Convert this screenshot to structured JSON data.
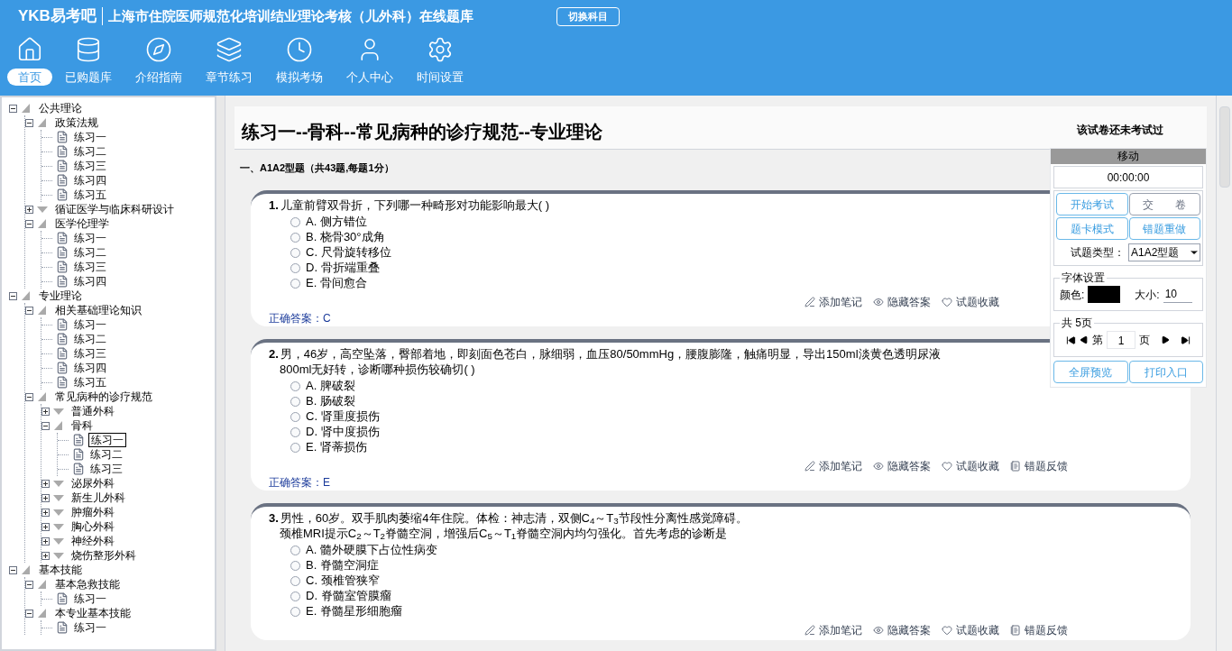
{
  "header": {
    "logo": "YKB易考吧",
    "title": "上海市住院医师规范化培训结业理论考核（儿外科）在线题库",
    "switch_button": "切换科目"
  },
  "nav": [
    {
      "label": "首页",
      "selected": true
    },
    {
      "label": "已购题库",
      "selected": false
    },
    {
      "label": "介绍指南",
      "selected": false
    },
    {
      "label": "章节练习",
      "selected": false
    },
    {
      "label": "模拟考场",
      "selected": false
    },
    {
      "label": "个人中心",
      "selected": false
    },
    {
      "label": "时间设置",
      "selected": false
    }
  ],
  "tree": [
    {
      "label": "公共理论",
      "expanded": true,
      "children": [
        {
          "label": "政策法规",
          "expanded": true,
          "children": [
            {
              "label": "练习一",
              "selected": false
            },
            {
              "label": "练习二",
              "selected": false
            },
            {
              "label": "练习三",
              "selected": false
            },
            {
              "label": "练习四",
              "selected": false
            },
            {
              "label": "练习五",
              "selected": false
            }
          ]
        },
        {
          "label": "循证医学与临床科研设计",
          "expanded": false
        },
        {
          "label": "医学伦理学",
          "expanded": true,
          "children": [
            {
              "label": "练习一",
              "selected": false
            },
            {
              "label": "练习二",
              "selected": false
            },
            {
              "label": "练习三",
              "selected": false
            },
            {
              "label": "练习四",
              "selected": false
            }
          ]
        }
      ]
    },
    {
      "label": "专业理论",
      "expanded": true,
      "children": [
        {
          "label": "相关基础理论知识",
          "expanded": true,
          "children": [
            {
              "label": "练习一",
              "selected": false
            },
            {
              "label": "练习二",
              "selected": false
            },
            {
              "label": "练习三",
              "selected": false
            },
            {
              "label": "练习四",
              "selected": false
            },
            {
              "label": "练习五",
              "selected": false
            }
          ]
        },
        {
          "label": "常见病种的诊疗规范",
          "expanded": true,
          "children": [
            {
              "label": "普通外科",
              "expanded": false
            },
            {
              "label": "骨科",
              "expanded": true,
              "children": [
                {
                  "label": "练习一",
                  "selected": true
                },
                {
                  "label": "练习二",
                  "selected": false
                },
                {
                  "label": "练习三",
                  "selected": false
                }
              ]
            },
            {
              "label": "泌尿外科",
              "expanded": false
            },
            {
              "label": "新生儿外科",
              "expanded": false
            },
            {
              "label": "肿瘤外科",
              "expanded": false
            },
            {
              "label": "胸心外科",
              "expanded": false
            },
            {
              "label": "神经外科",
              "expanded": false
            },
            {
              "label": "烧伤整形外科",
              "expanded": false
            }
          ]
        }
      ]
    },
    {
      "label": "基本技能",
      "expanded": true,
      "children": [
        {
          "label": "基本急救技能",
          "expanded": true,
          "children": [
            {
              "label": "练习一",
              "selected": false
            }
          ]
        },
        {
          "label": "本专业基本技能",
          "expanded": true,
          "children": [
            {
              "label": "练习一",
              "selected": false
            }
          ]
        }
      ]
    }
  ],
  "paper": {
    "title": "练习一--骨科--常见病种的诊疗规范--专业理论",
    "status": "该试卷还未考试过",
    "section": "一、A1A2型题（共43题,每题1分）"
  },
  "questions": [
    {
      "number": "1.",
      "lines": [
        "儿童前臂双骨折，下列哪一种畸形对功能影响最大( )"
      ],
      "options": [
        {
          "text": "A. 侧方错位",
          "selected": false
        },
        {
          "text": "B. 桡骨30°成角",
          "selected": false
        },
        {
          "text": "C. 尺骨旋转移位",
          "selected": false
        },
        {
          "text": "D. 骨折端重叠",
          "selected": false
        },
        {
          "text": "E. 骨间愈合",
          "selected": false
        }
      ],
      "actions": [
        "添加笔记",
        "隐藏答案",
        "试题收藏"
      ],
      "answer_label": "正确答案：",
      "answer": "C"
    },
    {
      "number": "2.",
      "lines": [
        "男，46岁，高空坠落，臀部着地，即刻面色苍白，脉细弱，血压80/50mmHg，腰腹膨隆，触痛明显，导出150ml淡黄色透明尿液",
        "800ml无好转，诊断哪种损伤较确切( )"
      ],
      "options": [
        {
          "text": "A. 脾破裂",
          "selected": false
        },
        {
          "text": "B. 肠破裂",
          "selected": false
        },
        {
          "text": "C. 肾重度损伤",
          "selected": false
        },
        {
          "text": "D. 肾中度损伤",
          "selected": false
        },
        {
          "text": "E. 肾蒂损伤",
          "selected": false
        }
      ],
      "actions": [
        "添加笔记",
        "隐藏答案",
        "试题收藏",
        "错题反馈"
      ],
      "answer_label": "正确答案：",
      "answer": "E"
    },
    {
      "number": "3.",
      "lines": [
        "男性，60岁。双手肌肉萎缩4年住院。体检：神志清，双侧C$_{4}$～T$_{3}$节段性分离性感觉障碍。",
        "颈椎MRI提示C$_{2}$～T$_{2}$脊髓空洞，增强后C$_{5}$～T$_{1}$脊髓空洞内均匀强化。首先考虑的诊断是"
      ],
      "options": [
        {
          "text": "A. 髓外硬膜下占位性病变",
          "selected": false
        },
        {
          "text": "B. 脊髓空洞症",
          "selected": false
        },
        {
          "text": "C. 颈椎管狭窄",
          "selected": false
        },
        {
          "text": "D. 脊髓室管膜瘤",
          "selected": false
        },
        {
          "text": "E. 脊髓星形细胞瘤",
          "selected": false
        }
      ],
      "actions": [
        "添加笔记",
        "隐藏答案",
        "试题收藏",
        "错题反馈"
      ]
    }
  ],
  "panel": {
    "handle": "移动",
    "timer": "00:00:00",
    "buttons": [
      "开始考试",
      "交　　卷",
      "题卡模式",
      "错题重做"
    ],
    "type_label": "试题类型：",
    "type_value": "A1A2型题",
    "font_legend": "字体设置",
    "color_label": "颜色:",
    "size_label": "大小:",
    "size_value": "10",
    "pager_legend": "共 5页",
    "page_prefix": "第",
    "page_value": "1",
    "page_suffix": "页",
    "bottom_buttons": [
      "全屏预览",
      "打印入口"
    ]
  }
}
